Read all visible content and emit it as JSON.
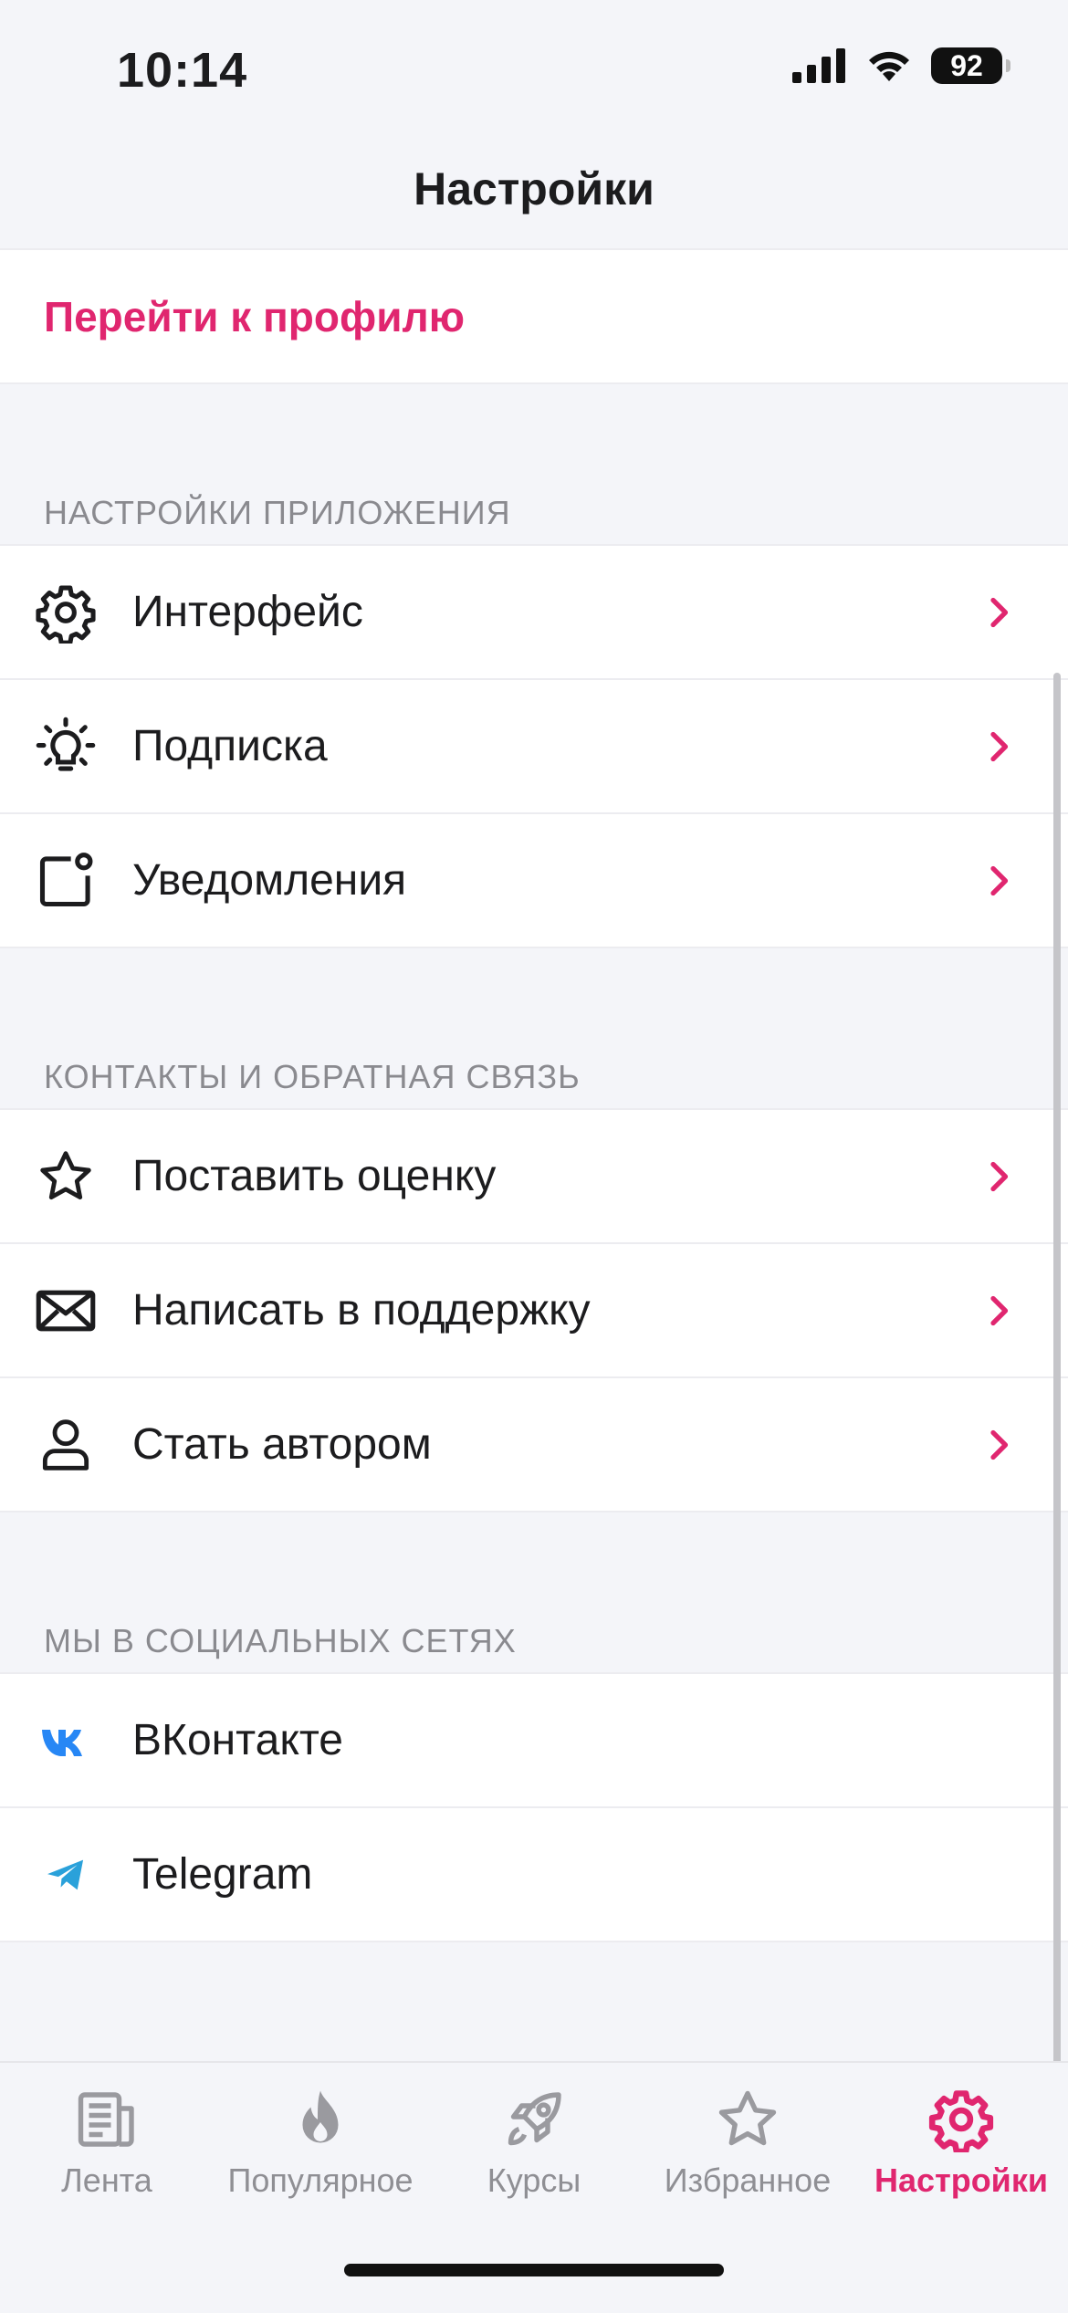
{
  "status_bar": {
    "time": "10:14",
    "battery": "92"
  },
  "nav": {
    "title": "Настройки"
  },
  "profile": {
    "link_label": "Перейти к профилю"
  },
  "sections": {
    "app_settings": {
      "header": "НАСТРОЙКИ ПРИЛОЖЕНИЯ",
      "items": [
        {
          "label": "Интерфейс",
          "icon": "gear-icon"
        },
        {
          "label": "Подписка",
          "icon": "lightbulb-icon"
        },
        {
          "label": "Уведомления",
          "icon": "notification-icon"
        }
      ]
    },
    "contacts": {
      "header": "КОНТАКТЫ И ОБРАТНАЯ СВЯЗЬ",
      "items": [
        {
          "label": "Поставить оценку",
          "icon": "star-icon"
        },
        {
          "label": "Написать в поддержку",
          "icon": "envelope-icon"
        },
        {
          "label": "Стать автором",
          "icon": "user-icon"
        }
      ]
    },
    "social": {
      "header": "МЫ В СОЦИАЛЬНЫХ СЕТЯХ",
      "items": [
        {
          "label": "ВКонтакте",
          "icon": "vk-icon"
        },
        {
          "label": "Telegram",
          "icon": "telegram-icon"
        }
      ]
    }
  },
  "tab_bar": {
    "tabs": [
      {
        "label": "Лента",
        "icon": "news-icon"
      },
      {
        "label": "Популярное",
        "icon": "flame-icon"
      },
      {
        "label": "Курсы",
        "icon": "rocket-icon"
      },
      {
        "label": "Избранное",
        "icon": "star-icon"
      },
      {
        "label": "Настройки",
        "icon": "gear-icon",
        "active": true
      }
    ]
  },
  "colors": {
    "accent": "#e0266f",
    "background": "#f4f5f9",
    "vk": "#2787f5",
    "telegram": "#2aa1da"
  }
}
